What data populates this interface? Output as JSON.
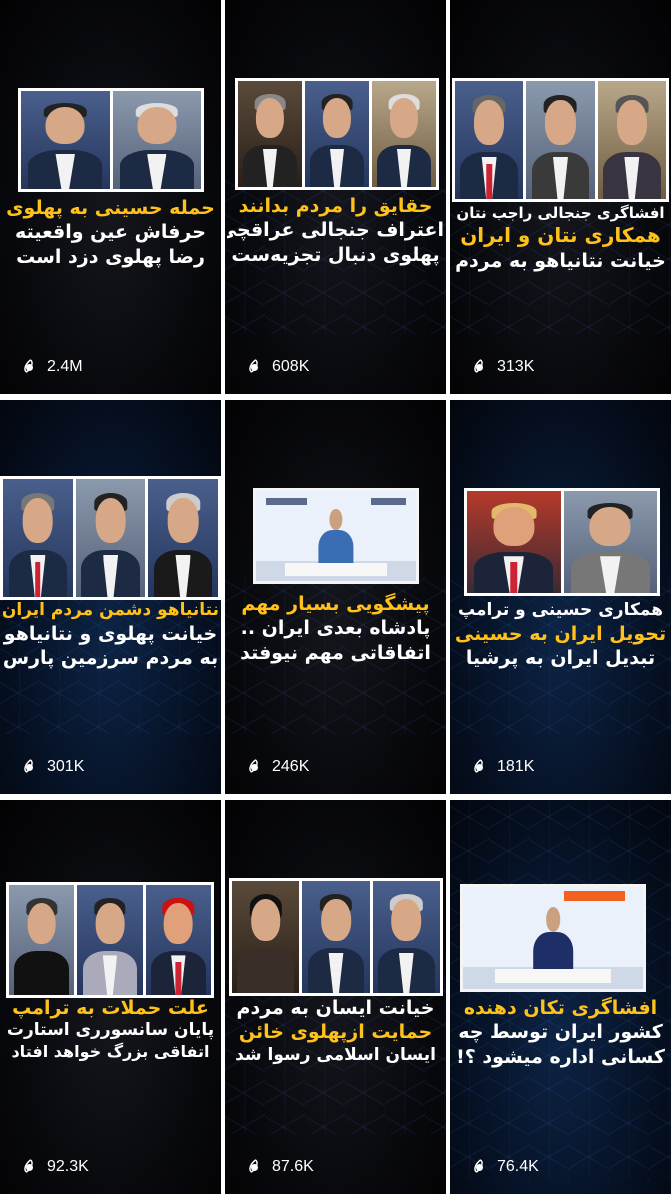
{
  "colors": {
    "accent_yellow": "#ffc21a",
    "text_white": "#ffffff",
    "background": "#05060c"
  },
  "icons": {
    "views": "eye-icon"
  },
  "videos": [
    {
      "lines": [
        {
          "text": "حمله حسینی به پهلوی",
          "color": "yellow"
        },
        {
          "text": "حرفاش عین واقعیته",
          "color": "white"
        },
        {
          "text": "رضا پهلوی دزد است",
          "color": "white"
        }
      ],
      "views": "2.4M"
    },
    {
      "lines": [
        {
          "text": "حقایق را مردم بدانند",
          "color": "yellow"
        },
        {
          "text": "اعتراف جنجالی عراقچی",
          "color": "white"
        },
        {
          "text": "پهلوی دنبال تجزیه‌ست",
          "color": "white"
        }
      ],
      "views": "608K"
    },
    {
      "lines": [
        {
          "text": "افشاگری جنجالی راجب نتان",
          "color": "white"
        },
        {
          "text": "همکاری نتان و ایران",
          "color": "yellow"
        },
        {
          "text": "خیانت نتانیاهو به مردم",
          "color": "white"
        }
      ],
      "views": "313K"
    },
    {
      "lines": [
        {
          "text": "نتانیاهو دشمن مردم ایران",
          "color": "yellow"
        },
        {
          "text": "خیانت پهلوی و نتانیاهو",
          "color": "white"
        },
        {
          "text": "به مردم سرزمین پارس",
          "color": "white"
        }
      ],
      "views": "301K"
    },
    {
      "lines": [
        {
          "text": "پیشگویی بسیار مهم",
          "color": "yellow"
        },
        {
          "text": "پادشاه بعدی ایران ..",
          "color": "white"
        },
        {
          "text": "اتفاقاتی مهم نیوفتد",
          "color": "white"
        }
      ],
      "views": "246K"
    },
    {
      "lines": [
        {
          "text": "همکاری حسینی و ترامپ",
          "color": "white"
        },
        {
          "text": "تحویل ایران به حسینی",
          "color": "yellow"
        },
        {
          "text": "تبدیل ایران به پرشیا",
          "color": "white"
        }
      ],
      "views": "181K"
    },
    {
      "lines": [
        {
          "text": "علت حملات به ترامپ",
          "color": "yellow"
        },
        {
          "text": "پایان سانسورری استارت",
          "color": "white"
        },
        {
          "text": "اتفاقی بزرگ خواهد افتاد",
          "color": "white"
        }
      ],
      "views": "92.3K"
    },
    {
      "lines": [
        {
          "text": "خیانت ایسان به مردم",
          "color": "white"
        },
        {
          "text": "حمایت ازپهلوی خائن",
          "color": "yellow"
        },
        {
          "text": "ایسان اسلامی رسوا شد",
          "color": "white"
        }
      ],
      "views": "87.6K"
    },
    {
      "lines": [
        {
          "text": "افشاگری تکان دهنده",
          "color": "yellow"
        },
        {
          "text": "کشور ایران توسط چه",
          "color": "white"
        },
        {
          "text": "کسانی اداره میشود ؟!",
          "color": "white"
        }
      ],
      "views": "76.4K"
    }
  ]
}
